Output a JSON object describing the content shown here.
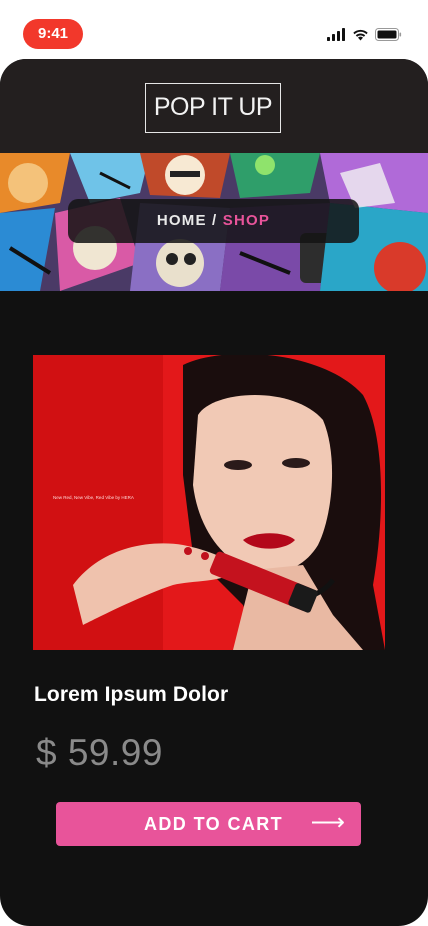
{
  "status_bar": {
    "time": "9:41",
    "icons": [
      "cellular-signal-icon",
      "wifi-icon",
      "battery-icon"
    ]
  },
  "header": {
    "logo_text": "POP IT UP"
  },
  "breadcrumb": {
    "home_label": "HOME",
    "separator": " / ",
    "current_label": "SHOP"
  },
  "product": {
    "image_caption": "New Red, New Vibe, Red Vibe by HERA",
    "name": "Lorem Ipsum Dolor",
    "price": "$ 59.99"
  },
  "cart_button": {
    "label": "ADD TO CART",
    "arrow": "⟶"
  },
  "colors": {
    "accent_pink": "#e8549a",
    "app_background": "#111111",
    "header_background": "#231f1f",
    "time_pill": "#f2382b",
    "price_gray": "#8a8a8a"
  }
}
